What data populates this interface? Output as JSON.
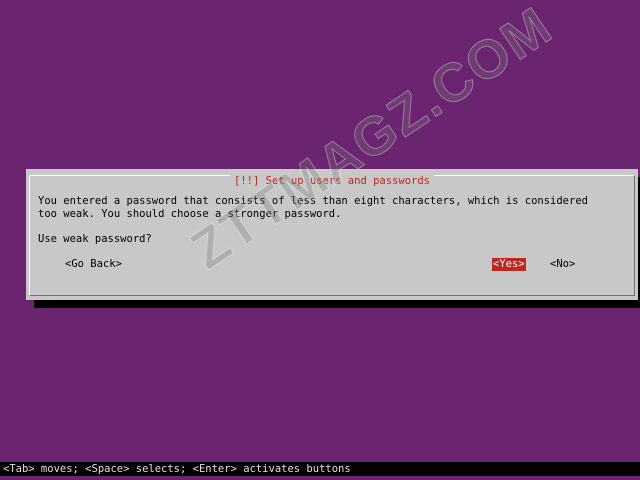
{
  "dialog": {
    "title": "[!!] Set up users and passwords",
    "message": "You entered a password that consists of less than eight characters, which is considered\ntoo weak. You should choose a stronger password.",
    "question": "Use weak password?",
    "buttons": {
      "back": "<Go Back>",
      "yes": "<Yes>",
      "no": "<No>"
    }
  },
  "status_bar": {
    "hint": "<Tab> moves; <Space> selects; <Enter> activates buttons"
  },
  "watermark": {
    "text": "ZTTMAGZ.COM"
  },
  "colors": {
    "background": "#6b2570",
    "dialog": "#c8c8c8",
    "accent": "#c0271f"
  }
}
